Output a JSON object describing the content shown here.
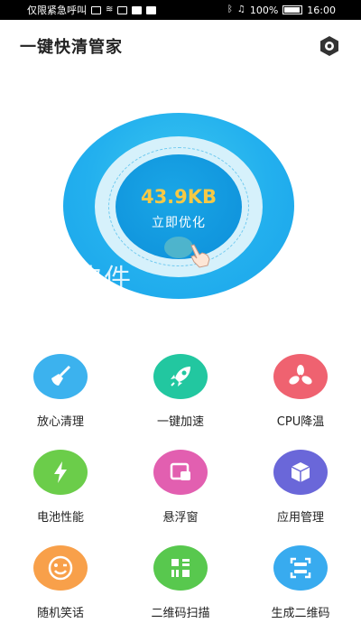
{
  "status_bar": {
    "left_text": "仅限紧急呼叫",
    "battery": "100%",
    "time": "16:00"
  },
  "header": {
    "title": "一键快清管家",
    "settings_icon": "hexagon-eye-icon"
  },
  "hero": {
    "size": "43.9KB",
    "action": "立即优化",
    "watermark": "软件"
  },
  "features": [
    {
      "label": "放心清理",
      "icon": "broom-icon",
      "color": "#3cb2ee"
    },
    {
      "label": "一键加速",
      "icon": "rocket-icon",
      "color": "#22c7a0"
    },
    {
      "label": "CPU降温",
      "icon": "fan-icon",
      "color": "#ef6270"
    },
    {
      "label": "电池性能",
      "icon": "lightning-icon",
      "color": "#6bcd4a"
    },
    {
      "label": "悬浮窗",
      "icon": "floating-window-icon",
      "color": "#e25fb0"
    },
    {
      "label": "应用管理",
      "icon": "cube-icon",
      "color": "#6a67d9"
    },
    {
      "label": "随机笑话",
      "icon": "wink-face-icon",
      "color": "#f8a04a"
    },
    {
      "label": "二维码扫描",
      "icon": "qr-scan-icon",
      "color": "#58c84e"
    },
    {
      "label": "生成二维码",
      "icon": "qr-generate-icon",
      "color": "#38abef"
    }
  ]
}
